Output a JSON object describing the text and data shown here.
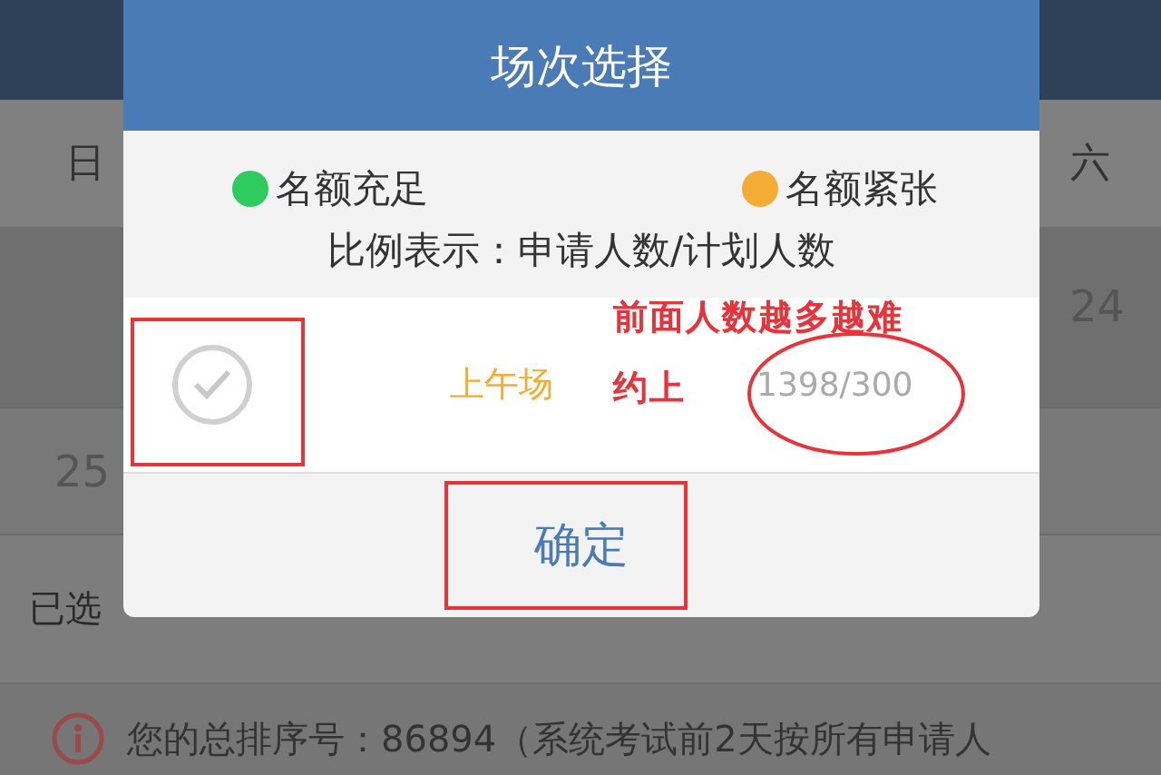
{
  "page": {
    "weekdays": [
      "日",
      "六"
    ],
    "week_rows": [
      {
        "right_date": "24"
      },
      {
        "left_date": "25"
      }
    ],
    "selected_label": "已选",
    "notice": "您的总排序号：86894（系统考试前2天按所有申请人"
  },
  "dialog": {
    "title": "场次选择",
    "legend": [
      {
        "label": "名额充足",
        "color": "#2ecc5e"
      },
      {
        "label": "名额紧张",
        "color": "#f5ac33"
      }
    ],
    "ratio_note": "比例表示：申请人数/计划人数",
    "sessions": [
      {
        "name": "上午场",
        "ratio": "1398/300",
        "checked": false
      }
    ],
    "confirm": "确定"
  },
  "annotations": [
    {
      "kind": "box"
    },
    {
      "kind": "box"
    },
    {
      "kind": "ellipse"
    },
    {
      "kind": "note",
      "text": "前面人数越多越难"
    },
    {
      "kind": "note",
      "text": "约上"
    }
  ]
}
